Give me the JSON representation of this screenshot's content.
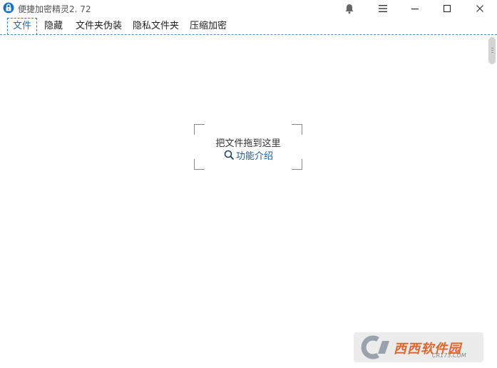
{
  "window": {
    "title": "便捷加密精灵2. 72"
  },
  "tabs": [
    {
      "label": "文件",
      "active": true
    },
    {
      "label": "隐藏",
      "active": false
    },
    {
      "label": "文件夹伪装",
      "active": false
    },
    {
      "label": "隐私文件夹",
      "active": false
    },
    {
      "label": "压缩加密",
      "active": false
    }
  ],
  "drop_zone": {
    "hint": "把文件拖到这里",
    "intro_link": "功能介绍"
  },
  "watermark": {
    "logo_text": "西西软件园",
    "site": "CR173.COM"
  },
  "colors": {
    "accent": "#1e6cb6",
    "tab_border": "#2b78c4"
  }
}
